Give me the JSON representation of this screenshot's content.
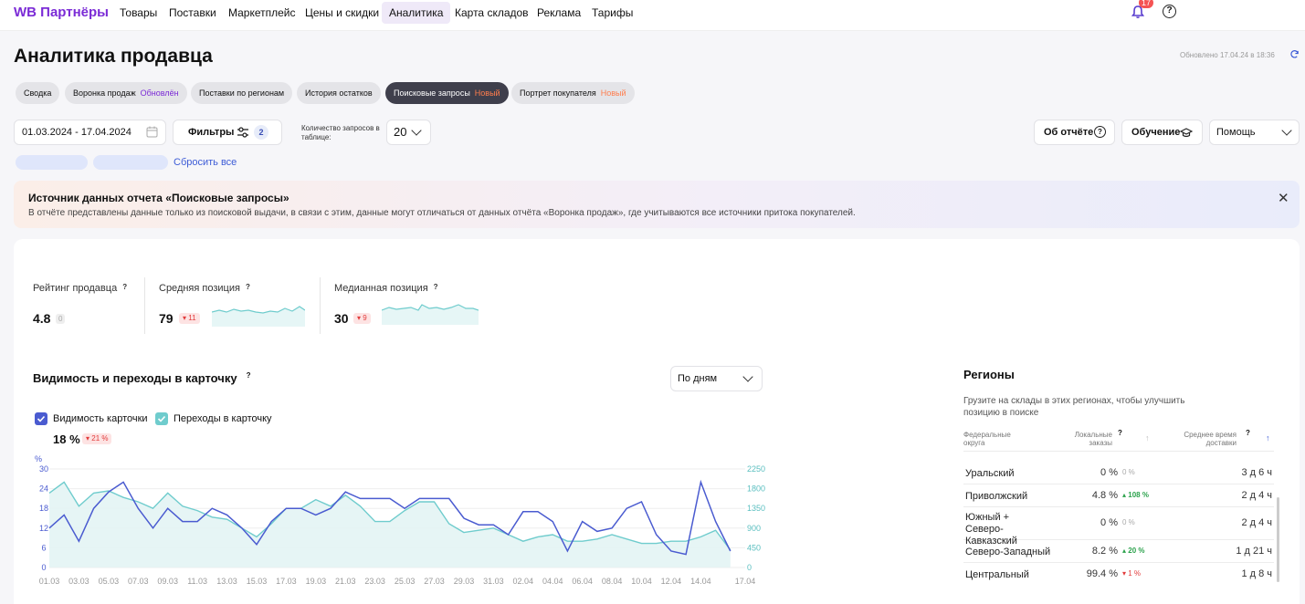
{
  "nav": {
    "logo": "WB Партнёры",
    "items": [
      "Товары",
      "Поставки",
      "Маркетплейс",
      "Цены и скидки",
      "Аналитика",
      "Карта складов",
      "Реклама",
      "Тарифы"
    ],
    "active": "Аналитика",
    "notifications": "17"
  },
  "page": {
    "title": "Аналитика продавца",
    "updated": "Обновлено 17.04.24 в 18:36"
  },
  "tabs": [
    {
      "label": "Сводка",
      "tag": ""
    },
    {
      "label": "Воронка продаж",
      "tag": "Обновлён"
    },
    {
      "label": "Поставки по регионам",
      "tag": ""
    },
    {
      "label": "История остатков",
      "tag": ""
    },
    {
      "label": "Поисковые запросы",
      "tag": "Новый"
    },
    {
      "label": "Портрет покупателя",
      "tag": "Новый"
    }
  ],
  "controls": {
    "date_range": "01.03.2024 - 17.04.2024",
    "filters_label": "Фильтры",
    "filters_count": "2",
    "query_count_label": "Количество запросов в таблице:",
    "query_count": "20",
    "reset_all": "Сбросить все",
    "about": "Об отчёте",
    "learning": "Обучение",
    "help": "Помощь"
  },
  "banner": {
    "title": "Источник данных отчета «Поисковые запросы»",
    "text": "В отчёте представлены данные только из поисковой выдачи, в связи с этим, данные могут отличаться от данных отчёта «Воронка продаж», где учитываются все источники притока покупателей."
  },
  "metrics": {
    "rating": {
      "label": "Рейтинг продавца",
      "value": "4.8",
      "delta": "0"
    },
    "avg_position": {
      "label": "Средняя позиция",
      "value": "79",
      "delta": "11"
    },
    "median_position": {
      "label": "Медианная позиция",
      "value": "30",
      "delta": "9"
    }
  },
  "visibility": {
    "title": "Видимость и переходы в карточку",
    "period": "По дням",
    "legend_visibility": "Видимость карточки",
    "legend_clicks": "Переходы в карточку",
    "value": "18 %",
    "delta": "21 %",
    "left_unit": "%"
  },
  "chart_data": {
    "type": "line",
    "x": [
      "01.03",
      "02.03",
      "03.03",
      "04.03",
      "05.03",
      "06.03",
      "07.03",
      "08.03",
      "09.03",
      "10.03",
      "11.03",
      "12.03",
      "13.03",
      "14.03",
      "15.03",
      "16.03",
      "17.03",
      "18.03",
      "19.03",
      "20.03",
      "21.03",
      "22.03",
      "23.03",
      "24.03",
      "25.03",
      "26.03",
      "27.03",
      "28.03",
      "29.03",
      "30.03",
      "31.03",
      "01.04",
      "02.04",
      "03.04",
      "04.04",
      "05.04",
      "06.04",
      "07.04",
      "08.04",
      "09.04",
      "10.04",
      "11.04",
      "12.04",
      "13.04",
      "14.04",
      "15.04",
      "16.04",
      "17.04"
    ],
    "x_tick_labels": [
      "01.03",
      "03.03",
      "05.03",
      "07.03",
      "09.03",
      "11.03",
      "13.03",
      "15.03",
      "17.03",
      "19.03",
      "21.03",
      "23.03",
      "25.03",
      "27.03",
      "29.03",
      "31.03",
      "02.04",
      "04.04",
      "06.04",
      "08.04",
      "10.04",
      "12.04",
      "14.04",
      "17.04"
    ],
    "y_left_ticks": [
      0,
      6,
      12,
      18,
      24,
      30
    ],
    "y_right_ticks": [
      0,
      450,
      900,
      1350,
      1800,
      2250
    ],
    "ylim_left": [
      0,
      30
    ],
    "ylim_right": [
      0,
      2250
    ],
    "series": [
      {
        "name": "Видимость карточки",
        "axis": "left",
        "color": "#4a5bd0",
        "values": [
          12,
          16,
          8,
          18,
          23,
          26,
          18,
          12,
          18,
          14,
          14,
          18,
          16,
          12,
          7,
          14,
          18,
          18,
          16,
          18,
          23,
          21,
          21,
          21,
          18,
          21,
          21,
          21,
          15,
          13,
          13,
          10,
          17,
          17,
          14,
          5,
          14,
          11,
          12,
          18,
          20,
          10,
          5,
          4,
          26,
          14,
          5
        ]
      },
      {
        "name": "Переходы в карточку",
        "axis": "right",
        "color": "#6fcccd",
        "values": [
          1700,
          1950,
          1400,
          1700,
          1750,
          1600,
          1500,
          1350,
          1700,
          1400,
          1300,
          1150,
          1100,
          900,
          700,
          1000,
          1350,
          1350,
          1550,
          1400,
          1650,
          1400,
          1050,
          1050,
          1300,
          1500,
          1500,
          1000,
          800,
          850,
          900,
          750,
          600,
          700,
          750,
          600,
          600,
          650,
          750,
          650,
          550,
          550,
          600,
          600,
          700,
          850,
          400
        ]
      }
    ],
    "grid": true,
    "legend": "top-left"
  },
  "regions": {
    "title": "Регионы",
    "description": "Грузите на склады в этих регионах, чтобы улучшить позицию в поиске",
    "col_district": "Федеральные округа",
    "col_local": "Локальные заказы",
    "col_delivery": "Среднее время доставки",
    "rows": [
      {
        "name": "Уральский",
        "percent": "0 %",
        "delta": "0 %",
        "dir": "none",
        "time": "3 д 6 ч"
      },
      {
        "name": "Приволжский",
        "percent": "4.8 %",
        "delta": "108 %",
        "dir": "up",
        "time": "2 д 4 ч"
      },
      {
        "name": "Южный + Северо-Кавказский",
        "percent": "0 %",
        "delta": "0 %",
        "dir": "none",
        "time": "2 д 4 ч"
      },
      {
        "name": "Северо-Западный",
        "percent": "8.2 %",
        "delta": "20 %",
        "dir": "up",
        "time": "1 д 21 ч"
      },
      {
        "name": "Центральный",
        "percent": "99.4 %",
        "delta": "1 %",
        "dir": "down",
        "time": "1 д 8 ч"
      }
    ]
  },
  "colors": {
    "brand": "#7b2bd6",
    "accent": "#4a5bd0",
    "teal": "#6fcccd",
    "negative": "#e23c3c",
    "positive": "#2ba24c"
  }
}
